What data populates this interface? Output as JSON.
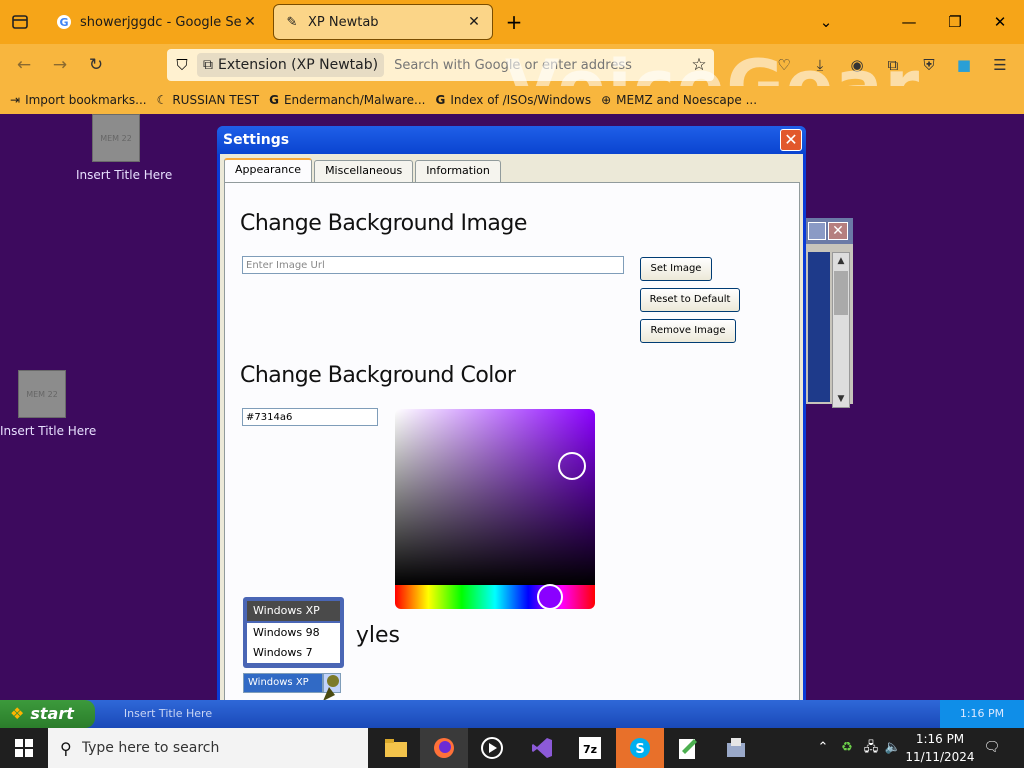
{
  "browser": {
    "tabs": [
      {
        "title": "showerjggdc - Google Search",
        "icon": "google-icon"
      },
      {
        "title": "XP Newtab",
        "icon": "puzzle-icon"
      }
    ],
    "urlbar": {
      "extension_label": "Extension (XP Newtab)",
      "placeholder": "Search with Google or enter address"
    },
    "watermark": "VoiceGear",
    "bookmarks": [
      {
        "label": "Import bookmarks...",
        "icon": "import-icon"
      },
      {
        "label": "RUSSIAN TEST",
        "icon": "bookmark-icon"
      },
      {
        "label": "Endermanch/Malware...",
        "icon": "google-icon"
      },
      {
        "label": "Index of /ISOs/Windows",
        "icon": "google-icon"
      },
      {
        "label": "MEMZ and Noescape ...",
        "icon": "globe-icon"
      }
    ]
  },
  "desktop": {
    "icons": [
      {
        "label": "Insert Title Here",
        "thumb": "MEM 22"
      },
      {
        "label": "Insert Title Here",
        "thumb": "MEM 22"
      }
    ]
  },
  "settings": {
    "title": "Settings",
    "tabs": [
      "Appearance",
      "Miscellaneous",
      "Information"
    ],
    "bg_image": {
      "heading": "Change Background Image",
      "url_placeholder": "Enter Image Url",
      "buttons": [
        "Set Image",
        "Reset to Default",
        "Remove Image"
      ]
    },
    "bg_color": {
      "heading": "Change Background Color",
      "value": "#7314a6"
    },
    "styles": {
      "heading_visible": "yles",
      "selected": "Windows XP",
      "options": [
        "Windows XP",
        "Windows 98",
        "Windows 7"
      ]
    }
  },
  "xp_taskbar": {
    "start": "start",
    "task": "Insert Title Here",
    "clock": "1:16 PM"
  },
  "taskbar": {
    "search_placeholder": "Type here to search",
    "time": "1:16 PM",
    "date": "11/11/2024"
  },
  "colors": {
    "accent": "#f6a518",
    "desktop": "#3d0a5e",
    "xp_blue": "#0a3bd6",
    "picker_color": "#7314a6"
  }
}
